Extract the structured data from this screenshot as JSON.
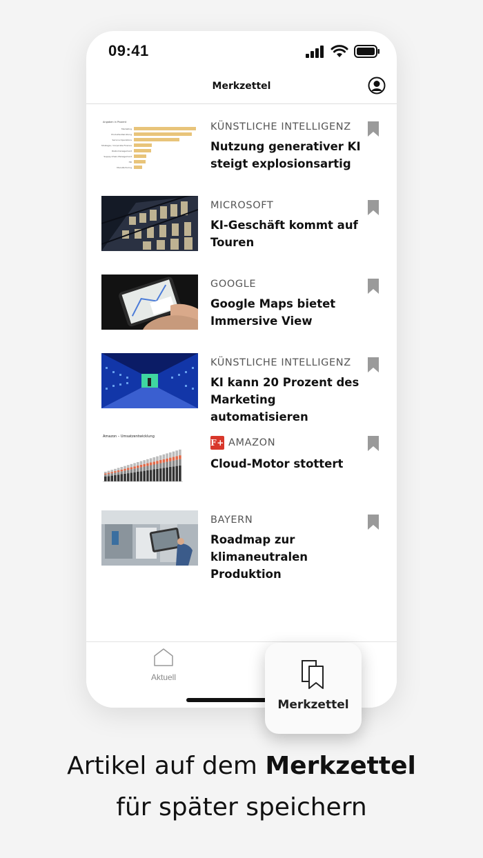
{
  "status_bar": {
    "time": "09:41"
  },
  "header": {
    "title": "Merkzettel"
  },
  "articles": [
    {
      "category": "KÜNSTLICHE INTELLIGENZ",
      "headline": "Nutzung generativer KI steigt explosionsartig",
      "thumb": "bar-chart"
    },
    {
      "category": "MICROSOFT",
      "headline": "KI-Geschäft kommt auf Touren",
      "thumb": "office-building"
    },
    {
      "category": "GOOGLE",
      "headline": "Google Maps bietet Immersive View",
      "thumb": "smartphone-map"
    },
    {
      "category": "KÜNSTLICHE INTELLIGENZ",
      "headline": "KI kann 20 Prozent des Marketing automatisieren",
      "thumb": "server-room"
    },
    {
      "category": "AMAZON",
      "headline": "Cloud-Motor stottert",
      "thumb": "stacked-bar-chart",
      "badge": "F+"
    },
    {
      "category": "BAYERN",
      "headline": "Roadmap zur klimaneutralen Produktion",
      "thumb": "factory-tablet"
    }
  ],
  "amazon_chart": {
    "title": "Amazon – Umsatzentwicklung"
  },
  "tab_bar": {
    "aktuell_label": "Aktuell",
    "merkzettel_label": "Merkzettel"
  },
  "caption": {
    "line1_normal": "Artikel auf dem ",
    "line1_bold": "Merkzettel",
    "line2": "für später speichern"
  },
  "colors": {
    "accent_red": "#d8372b",
    "bookmark_gray": "#9a9a9a",
    "chart_bar": "#e8c47a"
  }
}
